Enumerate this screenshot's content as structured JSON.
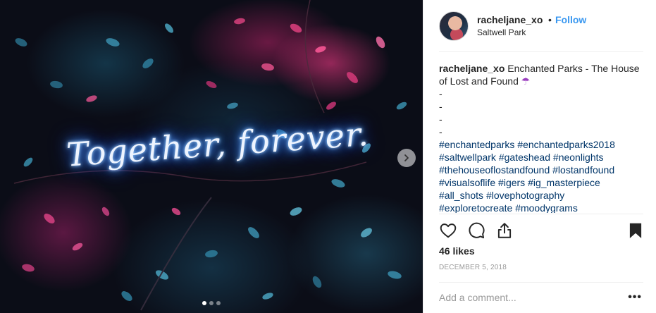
{
  "post": {
    "photo": {
      "neon_text": "Together, forever.",
      "carousel_total": 3,
      "carousel_active_index": 0
    },
    "author": {
      "username": "racheljane_xo",
      "separator": "•",
      "follow_label": "Follow",
      "location": "Saltwell Park"
    },
    "caption": {
      "username": "racheljane_xo",
      "text": "Enchanted Parks - The House of Lost and Found",
      "emoji": "☂",
      "spacer_lines": [
        "-",
        "-",
        "-",
        "-"
      ],
      "hashtags": [
        "#enchantedparks",
        "#enchantedparks2018",
        "#saltwellpark",
        "#gateshead",
        "#neonlights",
        "#thehouseoflostandfound",
        "#lostandfound",
        "#visualsoflife",
        "#igers",
        "#ig_masterpiece",
        "#all_shots",
        "#lovephotography",
        "#exploretocreate",
        "#moodygrams"
      ]
    },
    "likes": "46 likes",
    "date": "DECEMBER 5, 2018",
    "comment": {
      "placeholder": "Add a comment...",
      "more_label": "•••"
    }
  },
  "colors": {
    "link": "#3897f0",
    "hashtag": "#003569",
    "umbrella": "#9b3fbf"
  },
  "icons": [
    "heart-icon",
    "comment-icon",
    "share-icon",
    "bookmark-icon",
    "chevron-right-icon"
  ]
}
